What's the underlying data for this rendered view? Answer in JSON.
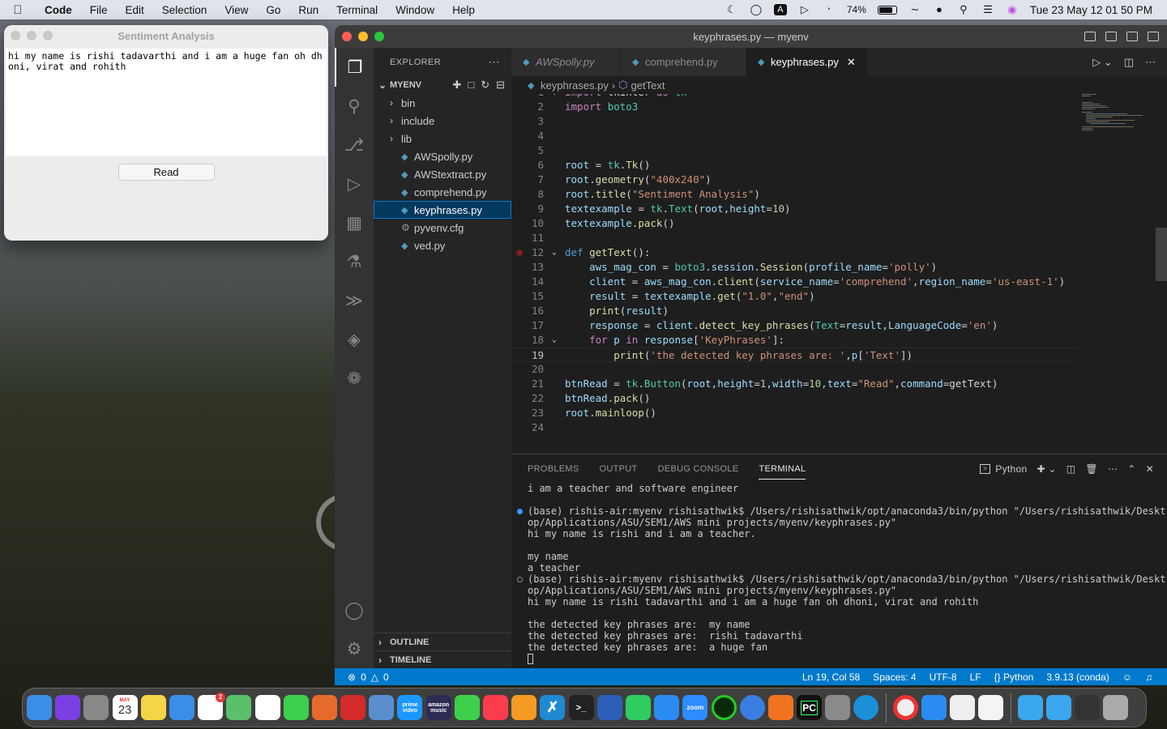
{
  "menubar": {
    "app": "Code",
    "items": [
      "File",
      "Edit",
      "Selection",
      "View",
      "Go",
      "Run",
      "Terminal",
      "Window",
      "Help"
    ],
    "battery": "74%",
    "clock": "Tue 23 May  12 01 50 PM"
  },
  "tk_window": {
    "title": "Sentiment Analysis",
    "text_content": "hi my name is rishi tadavarthi and i am a huge fan oh dhoni, virat and rohith",
    "button_label": "Read"
  },
  "vscode": {
    "window_title": "keyphrases.py — myenv",
    "explorer": {
      "header": "EXPLORER",
      "folder": "MYENV",
      "items": [
        {
          "label": "bin",
          "type": "folder"
        },
        {
          "label": "include",
          "type": "folder"
        },
        {
          "label": "lib",
          "type": "folder"
        },
        {
          "label": "AWSpolly.py",
          "type": "py"
        },
        {
          "label": "AWStextract.py",
          "type": "py"
        },
        {
          "label": "comprehend.py",
          "type": "py"
        },
        {
          "label": "keyphrases.py",
          "type": "py"
        },
        {
          "label": "pyvenv.cfg",
          "type": "cfg"
        },
        {
          "label": "ved.py",
          "type": "py"
        }
      ],
      "outline": "OUTLINE",
      "timeline": "TIMELINE"
    },
    "tabs": [
      {
        "label": "AWSpolly.py",
        "italic": true
      },
      {
        "label": "comprehend.py",
        "italic": false
      },
      {
        "label": "keyphrases.py",
        "italic": false
      }
    ],
    "breadcrumb": {
      "file": "keyphrases.py",
      "symbol": "getText"
    },
    "code_lines": [
      "import tkinter as tk",
      "import boto3",
      "",
      "",
      "",
      "root = tk.Tk()",
      "root.geometry(\"400x240\")",
      "root.title(\"Sentiment Analysis\")",
      "textexample = tk.Text(root,height=10)",
      "textexample.pack()",
      "",
      "def getText():",
      "    aws_mag_con = boto3.session.Session(profile_name='polly')",
      "    client = aws_mag_con.client(service_name='comprehend',region_name='us-east-1')",
      "    result = textexample.get(\"1.0\",\"end\")",
      "    print(result)",
      "    response = client.detect_key_phrases(Text=result,LanguageCode='en')",
      "    for p in response['KeyPhrases']:",
      "        print('the detected key phrases are: ',p['Text'])",
      "",
      "btnRead = tk.Button(root,height=1,width=10,text=\"Read\",command=getText)",
      "btnRead.pack()",
      "root.mainloop()",
      ""
    ],
    "panel": {
      "tabs": [
        "PROBLEMS",
        "OUTPUT",
        "DEBUG CONSOLE",
        "TERMINAL"
      ],
      "active_tab": "TERMINAL",
      "shell": "Python",
      "terminal_lines": [
        "i am a teacher and software engineer",
        "",
        "(base) rishis-air:myenv rishisathwik$ /Users/rishisathwik/opt/anaconda3/bin/python \"/Users/rishisathwik/Deskt",
        "op/Applications/ASU/SEM1/AWS mini projects/myenv/keyphrases.py\"",
        "hi my name is rishi and i am a teacher.",
        "",
        "my name",
        "a teacher",
        "(base) rishis-air:myenv rishisathwik$ /Users/rishisathwik/opt/anaconda3/bin/python \"/Users/rishisathwik/Deskt",
        "op/Applications/ASU/SEM1/AWS mini projects/myenv/keyphrases.py\"",
        "hi my name is rishi tadavarthi and i am a huge fan oh dhoni, virat and rohith",
        "",
        "the detected key phrases are:  my name",
        "the detected key phrases are:  rishi tadavarthi",
        "the detected key phrases are:  a huge fan"
      ]
    },
    "status": {
      "errors": "0",
      "warnings": "0",
      "position": "Ln 19, Col 58",
      "spaces": "Spaces: 4",
      "encoding": "UTF-8",
      "eol": "LF",
      "language": "Python",
      "interpreter": "3.9.13 (conda)"
    }
  },
  "dock": {
    "calendar_month": "MAY",
    "calendar_day": "23",
    "reminders_badge": "2",
    "apps": [
      "finder-icon",
      "siri-icon",
      "launchpad-icon",
      "calendar-icon",
      "notes-icon",
      "mail-icon",
      "reminders-icon",
      "maps-icon",
      "photos-icon",
      "messages-icon",
      "firefox-icon",
      "acrobat-icon",
      "preview-icon",
      "prime-video-icon",
      "amazon-music-icon",
      "facetime-icon",
      "music-icon",
      "books-icon",
      "vscode-icon",
      "terminal-icon",
      "word-icon",
      "whatsapp-icon",
      "appstore-icon",
      "zoom-icon",
      "spinner-icon",
      "globe-icon",
      "pen-icon",
      "pycharm-icon",
      "settings-icon",
      "edge-icon",
      "chrome-icon",
      "safari-icon",
      "textedit-icon",
      "file-icon",
      "folder-icon",
      "downloads-icon",
      "screenshot-icon",
      "trash-icon"
    ],
    "prime_label": "prime video",
    "amazon_label": "amazon music",
    "zoom_label": "zoom",
    "pc_label": "PC"
  }
}
